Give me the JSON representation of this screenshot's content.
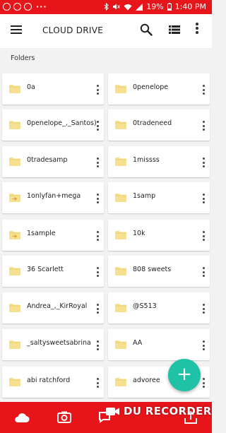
{
  "status_bar": {
    "battery": "19%",
    "time": "1:40 PM",
    "dots": "···",
    "left_icons": [
      "circle-icon",
      "circle-icon",
      "circle-icon"
    ],
    "right_icons": [
      "bluetooth-icon",
      "mute-icon",
      "wifi-icon",
      "signal-icon",
      "battery-icon"
    ]
  },
  "app_bar": {
    "title": "CLOUD DRIVE",
    "icons": [
      "menu-icon",
      "search-icon",
      "list-view-icon",
      "more-vert-icon"
    ]
  },
  "section": {
    "title": "Folders"
  },
  "folders": [
    {
      "name": "0a",
      "icon": "folder-icon"
    },
    {
      "name": "0penelope",
      "icon": "folder-icon"
    },
    {
      "name": "0penelope_,_Santos)",
      "icon": "folder-icon"
    },
    {
      "name": "0tradeneed",
      "icon": "folder-icon"
    },
    {
      "name": "0tradesamp",
      "icon": "folder-icon"
    },
    {
      "name": "1missss",
      "icon": "folder-icon"
    },
    {
      "name": "1onlyfan+mega",
      "icon": "shared-folder-icon"
    },
    {
      "name": "1samp",
      "icon": "folder-icon"
    },
    {
      "name": "1sample",
      "icon": "shared-folder-icon"
    },
    {
      "name": "10k",
      "icon": "folder-icon"
    },
    {
      "name": "36 Scarlett",
      "icon": "folder-icon"
    },
    {
      "name": "808 sweets",
      "icon": "folder-icon"
    },
    {
      "name": "Andrea_,_KirRoyal",
      "icon": "folder-icon"
    },
    {
      "name": "@S513",
      "icon": "folder-icon"
    },
    {
      "name": "_saltysweetsabrina",
      "icon": "folder-icon"
    },
    {
      "name": "AA",
      "icon": "folder-icon"
    },
    {
      "name": "abi ratchford",
      "icon": "folder-icon"
    },
    {
      "name": "advoree",
      "icon": "folder-icon"
    }
  ],
  "fab": {
    "label": "+",
    "icon": "add-icon"
  },
  "bottom_bar": {
    "tabs": [
      "cloud-drive-icon",
      "camera-uploads-icon",
      "chat-icon",
      "shared-icon"
    ]
  },
  "watermark": {
    "text": "DU RECORDER",
    "icon": "video-camera-icon"
  },
  "colors": {
    "brand_red": "#e7141a",
    "fab_teal": "#1fc2a7",
    "folder_yellow": "#f6e08f"
  }
}
